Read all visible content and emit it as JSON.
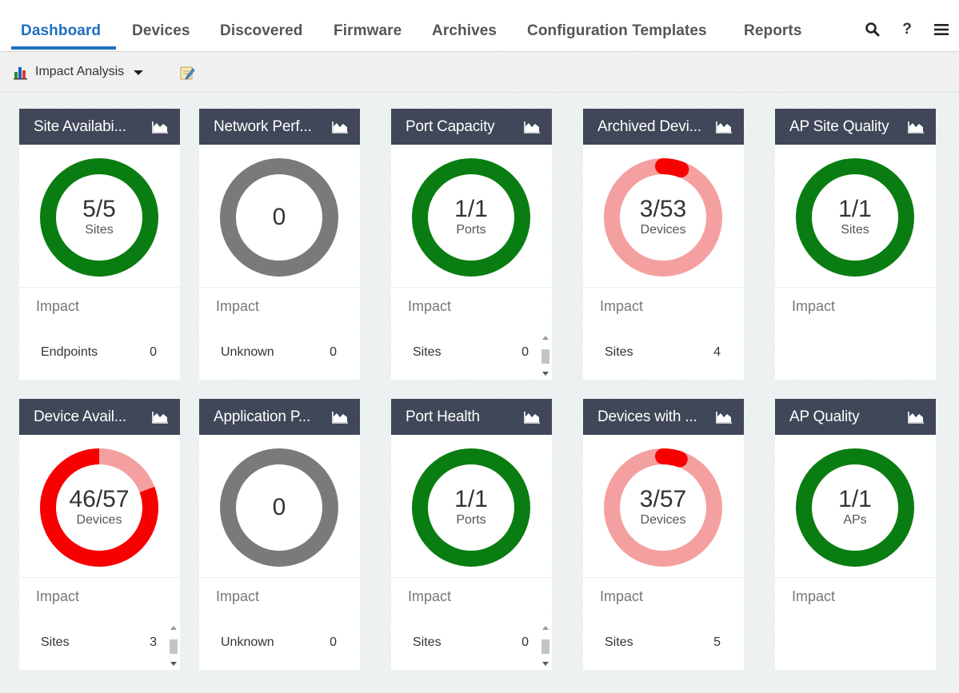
{
  "nav": {
    "tabs": [
      "Dashboard",
      "Devices",
      "Discovered",
      "Firmware",
      "Archives",
      "Configuration Templates",
      "Reports"
    ],
    "active_tab": "Dashboard",
    "icons": [
      "search-icon",
      "help-icon",
      "menu-icon"
    ],
    "help_glyph": "?"
  },
  "toolbar": {
    "dropdown_label": "Impact Analysis",
    "icons": [
      "bar-chart-icon",
      "edit-icon"
    ]
  },
  "colors": {
    "active_tab": "#1f6fbf",
    "card_header": "#3f4758",
    "ok_green": "#0a7d12",
    "critical_red": "#f60000",
    "light_red": "#f5a0a0",
    "unknown_gray": "#7a7a7a"
  },
  "widgets": [
    {
      "title": "Site Availabi...",
      "donut": {
        "value": "5/5",
        "unit": "Sites",
        "fraction": 1.0,
        "style": "green"
      },
      "impact_label": "Impact",
      "row": {
        "label": "Endpoints",
        "value": "0"
      },
      "scrollbar": false
    },
    {
      "title": "Network Perf...",
      "donut": {
        "value": "0",
        "unit": "",
        "fraction": 0,
        "style": "gray"
      },
      "impact_label": "Impact",
      "row": {
        "label": "Unknown",
        "value": "0"
      },
      "scrollbar": false
    },
    {
      "title": "Port Capacity",
      "donut": {
        "value": "1/1",
        "unit": "Ports",
        "fraction": 1.0,
        "style": "green"
      },
      "impact_label": "Impact",
      "row": {
        "label": "Sites",
        "value": "0"
      },
      "scrollbar": true
    },
    {
      "title": "Archived Devi...",
      "donut": {
        "value": "3/53",
        "unit": "Devices",
        "fraction": 0.0566,
        "style": "red-light"
      },
      "impact_label": "Impact",
      "row": {
        "label": "Sites",
        "value": "4"
      },
      "scrollbar": false
    },
    {
      "title": "AP Site Quality",
      "donut": {
        "value": "1/1",
        "unit": "Sites",
        "fraction": 1.0,
        "style": "green"
      },
      "impact_label": "Impact",
      "row": null,
      "scrollbar": false
    },
    {
      "title": "Device Avail...",
      "donut": {
        "value": "46/57",
        "unit": "Devices",
        "fraction": 0.807,
        "style": "red-main"
      },
      "impact_label": "Impact",
      "row": {
        "label": "Sites",
        "value": "3"
      },
      "scrollbar": true
    },
    {
      "title": "Application P...",
      "donut": {
        "value": "0",
        "unit": "",
        "fraction": 0,
        "style": "gray"
      },
      "impact_label": "Impact",
      "row": {
        "label": "Unknown",
        "value": "0"
      },
      "scrollbar": false
    },
    {
      "title": "Port Health",
      "donut": {
        "value": "1/1",
        "unit": "Ports",
        "fraction": 1.0,
        "style": "green"
      },
      "impact_label": "Impact",
      "row": {
        "label": "Sites",
        "value": "0"
      },
      "scrollbar": true
    },
    {
      "title": "Devices with ...",
      "donut": {
        "value": "3/57",
        "unit": "Devices",
        "fraction": 0.0526,
        "style": "red-light"
      },
      "impact_label": "Impact",
      "row": {
        "label": "Sites",
        "value": "5"
      },
      "scrollbar": false
    },
    {
      "title": "AP Quality",
      "donut": {
        "value": "1/1",
        "unit": "APs",
        "fraction": 1.0,
        "style": "green"
      },
      "impact_label": "Impact",
      "row": null,
      "scrollbar": false
    }
  ]
}
